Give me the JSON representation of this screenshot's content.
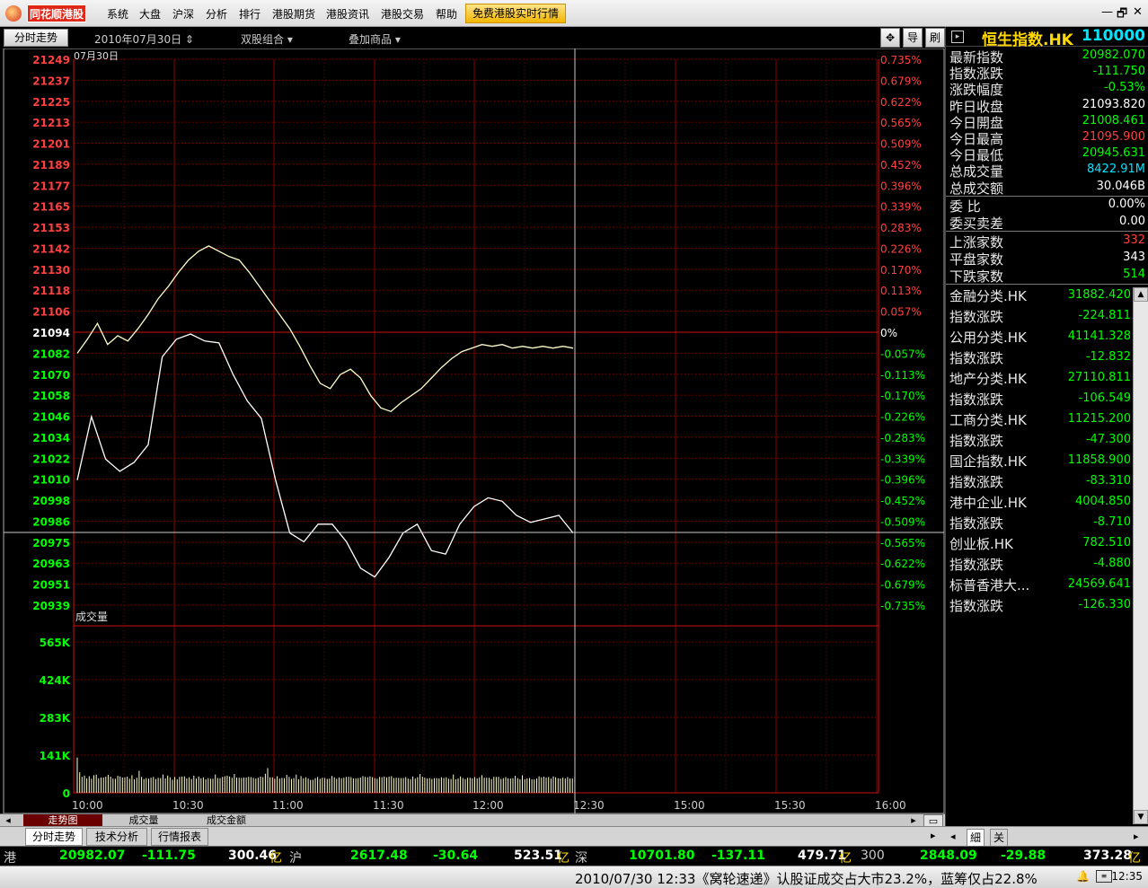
{
  "menubar": {
    "logo": "同花顺港股",
    "items": [
      "系统",
      "大盘",
      "沪深",
      "分析",
      "排行",
      "港股期货",
      "港股资讯",
      "港股交易",
      "帮助"
    ],
    "highlight": "免费港股实时行情",
    "win_min": "—",
    "win_restore": "🗗",
    "win_close": "✕"
  },
  "toolbar": {
    "tab": "分时走势",
    "date": "2010年07月30日",
    "combo1": "双股组合",
    "combo2": "叠加商品",
    "btn_cross": "✥",
    "btn_guide": "导",
    "btn_refresh": "刷"
  },
  "chart_data": {
    "type": "line",
    "date_label": "07月30日",
    "volume_label": "成交量",
    "prev_close": 21094,
    "price_ticks": [
      "21249",
      "21237",
      "21225",
      "21213",
      "21201",
      "21189",
      "21177",
      "21165",
      "21153",
      "21142",
      "21130",
      "21118",
      "21106",
      "21094",
      "21082",
      "21070",
      "21058",
      "21046",
      "21034",
      "21022",
      "21010",
      "20998",
      "20986",
      "20975",
      "20963",
      "20951",
      "20939"
    ],
    "pct_ticks": [
      "0.735%",
      "0.679%",
      "0.622%",
      "0.565%",
      "0.509%",
      "0.452%",
      "0.396%",
      "0.339%",
      "0.283%",
      "0.226%",
      "0.170%",
      "0.113%",
      "0.057%",
      "0%",
      "-0.057%",
      "-0.113%",
      "-0.170%",
      "-0.226%",
      "-0.283%",
      "-0.339%",
      "-0.396%",
      "-0.452%",
      "-0.509%",
      "-0.565%",
      "-0.622%",
      "-0.679%",
      "-0.735%"
    ],
    "volume_ticks": [
      "565K",
      "424K",
      "283K",
      "141K",
      "0"
    ],
    "time_ticks": [
      "10:00",
      "10:30",
      "11:00",
      "11:30",
      "12:00",
      "12:30",
      "15:00",
      "15:30",
      "16:00"
    ],
    "series": [
      {
        "values": [
          21082,
          21090,
          21099,
          21087,
          21092,
          21089,
          21096,
          21104,
          21113,
          21120,
          21128,
          21135,
          21140,
          21143,
          21140,
          21137,
          21135,
          21128,
          21120,
          21112,
          21104,
          21096,
          21086,
          21075,
          21065,
          21062,
          21070,
          21073,
          21068,
          21058,
          21051,
          21049,
          21054,
          21058,
          21062,
          21068,
          21074,
          21079,
          21083,
          21085,
          21087,
          21086,
          21087,
          21085,
          21086,
          21085,
          21086,
          21085,
          21086,
          21085
        ]
      },
      {
        "values": [
          21010,
          21046,
          21022,
          21015,
          21020,
          21030,
          21080,
          21090,
          21093,
          21089,
          21088,
          21070,
          21055,
          21045,
          21010,
          20980,
          20975,
          20985,
          20985,
          20975,
          20960,
          20955,
          20966,
          20980,
          20985,
          20970,
          20968,
          20985,
          20995,
          21000,
          20998,
          20990,
          20986,
          20988,
          20990,
          20980
        ]
      }
    ],
    "volume": [
      241,
      140,
      109,
      118,
      98,
      113,
      96,
      120,
      124,
      99,
      104,
      104,
      110,
      122,
      110,
      97,
      96,
      117,
      111,
      104,
      105,
      110,
      96,
      120,
      92,
      103,
      150,
      108,
      94,
      100,
      96,
      103,
      108,
      94,
      102,
      100,
      125,
      98,
      118,
      106,
      89,
      108,
      91,
      108,
      110,
      112,
      98,
      106,
      94,
      117,
      97,
      111,
      99,
      105,
      92,
      100,
      96,
      96,
      125,
      101,
      100,
      108,
      113,
      117,
      111,
      103,
      128,
      104,
      103,
      101,
      104,
      104,
      109,
      107,
      102,
      97,
      103,
      110,
      107,
      130,
      168,
      105,
      106,
      96,
      113,
      97,
      102,
      100,
      123,
      108,
      95,
      101,
      124,
      92,
      114,
      99,
      106,
      97,
      88,
      89,
      100,
      108,
      96,
      103,
      101,
      95,
      97,
      115,
      106,
      96,
      104,
      99,
      103,
      108,
      109,
      107,
      98,
      98,
      100,
      104,
      114,
      108,
      106,
      112,
      107,
      100,
      96,
      108,
      106,
      110,
      106,
      110,
      113,
      101,
      103,
      102,
      100,
      100,
      107,
      97,
      93,
      111,
      97,
      107,
      128,
      109,
      103,
      98,
      100,
      95,
      99,
      100,
      98,
      106,
      101,
      106,
      96,
      94,
      125,
      92,
      98,
      111,
      101,
      93,
      103,
      103,
      98,
      107,
      97,
      106,
      120,
      103,
      103,
      102,
      94,
      109,
      108,
      108,
      95,
      100,
      107,
      99,
      97,
      100,
      116,
      100,
      93,
      119,
      93,
      98,
      101,
      92,
      91,
      97,
      112,
      105,
      110,
      104,
      107,
      97,
      111,
      106,
      99,
      98,
      103,
      98,
      107,
      97,
      98,
      108
    ]
  },
  "hscroll_tabs": [
    "走势图",
    "成交量",
    "成交金额"
  ],
  "bottom_tabs": [
    "分时走势",
    "技术分析",
    "行情报表"
  ],
  "rp_tabs": [
    "細",
    "关"
  ],
  "rpanel": {
    "name": "恒生指数.HK",
    "code": "110000",
    "rows": [
      {
        "label": "最新指数",
        "value": "20982.070",
        "color": "#00ff00"
      },
      {
        "label": "指数涨跌",
        "value": "-111.750",
        "color": "#00ff00"
      },
      {
        "label": "涨跌幅度",
        "value": "-0.53%",
        "color": "#00ff00"
      },
      {
        "label": "昨日收盘",
        "value": "21093.820",
        "color": "#ffffff"
      },
      {
        "label": "今日開盘",
        "value": "21008.461",
        "color": "#00ff00"
      },
      {
        "label": "今日最高",
        "value": "21095.900",
        "color": "#ff4040"
      },
      {
        "label": "今日最低",
        "value": "20945.631",
        "color": "#00ff00"
      },
      {
        "label": "总成交量",
        "value": "8422.91M",
        "color": "#00e5ff"
      },
      {
        "label": "总成交额",
        "value": "30.046B",
        "color": "#ffffff"
      }
    ],
    "ratio_rows": [
      {
        "label": "委  比",
        "value": "0.00%",
        "color": "#ffffff"
      },
      {
        "label": "委买卖差",
        "value": "0.00",
        "color": "#ffffff"
      }
    ],
    "count_rows": [
      {
        "label": "上涨家数",
        "value": "332",
        "color": "#ff4040"
      },
      {
        "label": "平盘家数",
        "value": "343",
        "color": "#ffffff"
      },
      {
        "label": "下跌家数",
        "value": "514",
        "color": "#00ff00"
      }
    ],
    "sectors": [
      {
        "label": "金融分类.HK",
        "value": "31882.420",
        "color": "#00ff00"
      },
      {
        "label": "指数涨跌",
        "value": "-224.811",
        "color": "#00ff00"
      },
      {
        "label": "公用分类.HK",
        "value": "41141.328",
        "color": "#00ff00"
      },
      {
        "label": "指数涨跌",
        "value": "-12.832",
        "color": "#00ff00"
      },
      {
        "label": "地产分类.HK",
        "value": "27110.811",
        "color": "#00ff00"
      },
      {
        "label": "指数涨跌",
        "value": "-106.549",
        "color": "#00ff00"
      },
      {
        "label": "工商分类.HK",
        "value": "11215.200",
        "color": "#00ff00"
      },
      {
        "label": "指数涨跌",
        "value": "-47.300",
        "color": "#00ff00"
      },
      {
        "label": "国企指数.HK",
        "value": "11858.900",
        "color": "#00ff00"
      },
      {
        "label": "指数涨跌",
        "value": "-83.310",
        "color": "#00ff00"
      },
      {
        "label": "港中企业.HK",
        "value": "4004.850",
        "color": "#00ff00"
      },
      {
        "label": "指数涨跌",
        "value": "-8.710",
        "color": "#00ff00"
      },
      {
        "label": "创业板.HK",
        "value": "782.510",
        "color": "#00ff00"
      },
      {
        "label": "指数涨跌",
        "value": "-4.880",
        "color": "#00ff00"
      },
      {
        "label": "标普香港大...",
        "value": "24569.641",
        "color": "#00ff00"
      },
      {
        "label": "指数涨跌",
        "value": "-126.330",
        "color": "#00ff00"
      }
    ]
  },
  "ticker": {
    "hk_label": "港",
    "hk_price": "20982.07",
    "hk_chg": "-111.75",
    "hk_amt": "300.46",
    "hk_unit": "亿",
    "sh_label": "沪",
    "sh_price": "2617.48",
    "sh_chg": "-30.64",
    "sh_amt": "523.51",
    "sh_unit": "亿",
    "sz_label": "深",
    "sz_price": "10701.80",
    "sz_chg": "-137.11",
    "sz_amt": "479.71",
    "sz_unit": "亿",
    "hs_label": "300",
    "hs_price": "2848.09",
    "hs_chg": "-29.88",
    "hs_amt": "373.28",
    "hs_unit": "亿"
  },
  "status": {
    "text": "2010/07/30 12:33《窝轮速递》认股证成交占大市23.2%，蓝筹仅占22.8%",
    "time": "12:35"
  },
  "colors": {
    "up": "#ff4040",
    "down": "#00ff00",
    "grid": "#8b0000",
    "line1": "#ffffcc",
    "line2": "#ffffff"
  }
}
